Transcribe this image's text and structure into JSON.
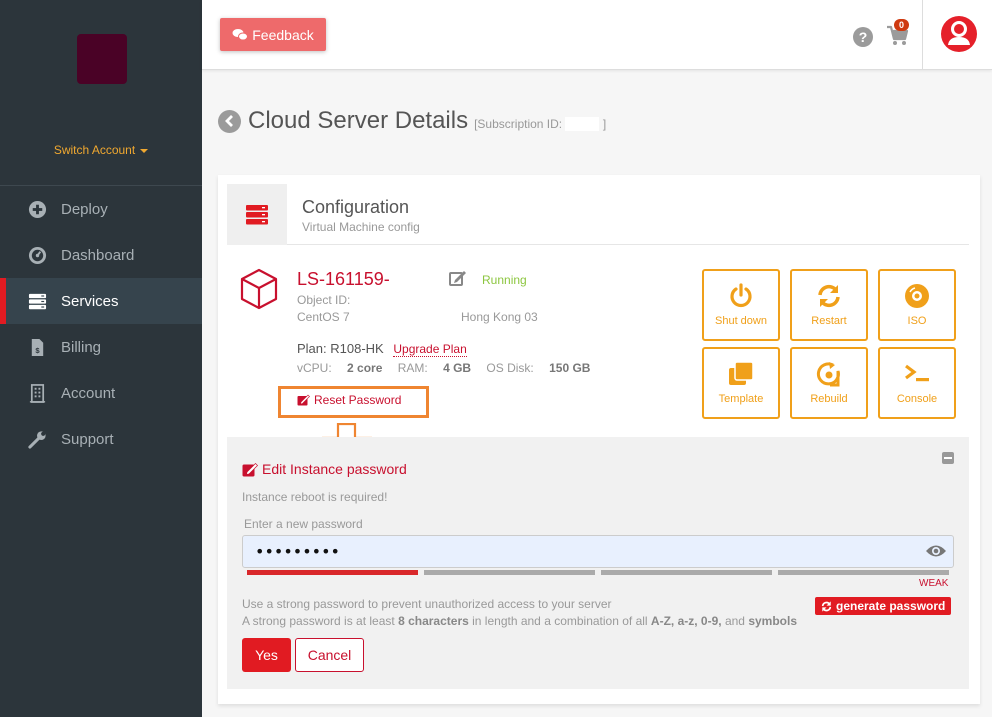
{
  "sidebar": {
    "switch_account_label": "Switch Account",
    "items": [
      {
        "label": "Deploy",
        "icon": "plus-circle-icon",
        "active": false
      },
      {
        "label": "Dashboard",
        "icon": "speedometer-icon",
        "active": false
      },
      {
        "label": "Services",
        "icon": "server-icon",
        "active": true
      },
      {
        "label": "Billing",
        "icon": "invoice-icon",
        "active": false
      },
      {
        "label": "Account",
        "icon": "building-icon",
        "active": false
      },
      {
        "label": "Support",
        "icon": "wrench-icon",
        "active": false
      }
    ]
  },
  "topbar": {
    "feedback_label": "Feedback",
    "help_glyph": "?",
    "cart_count": "0"
  },
  "page": {
    "title": "Cloud Server Details",
    "subscription_prefix": "[Subscription ID:",
    "subscription_suffix": "]"
  },
  "config": {
    "title": "Configuration",
    "subtitle": "Virtual Machine config"
  },
  "vm": {
    "name": "LS-161159-",
    "status": "Running",
    "status_color": "#8cc63f",
    "object_id_label": "Object ID:",
    "os": "CentOS 7",
    "region": "Hong Kong 03",
    "plan_label": "Plan:",
    "plan": "R108-HK",
    "upgrade_label": "Upgrade Plan",
    "vcpu_label": "vCPU:",
    "vcpu": "2 core",
    "ram_label": "RAM:",
    "ram": "4 GB",
    "disk_label": "OS Disk:",
    "disk": "150 GB",
    "reset_password_label": "Reset Password"
  },
  "actions": [
    {
      "label": "Shut down",
      "icon": "power-icon"
    },
    {
      "label": "Restart",
      "icon": "refresh-icon"
    },
    {
      "label": "ISO",
      "icon": "disc-icon"
    },
    {
      "label": "Template",
      "icon": "copy-icon"
    },
    {
      "label": "Rebuild",
      "icon": "rebuild-icon"
    },
    {
      "label": "Console",
      "icon": "terminal-icon"
    }
  ],
  "password_panel": {
    "title": "Edit Instance password",
    "reboot_note": "Instance reboot is required!",
    "field_label": "Enter a new password",
    "field_value": "•••••••••",
    "strength_level": "1 of 4",
    "strength_label": "WEAK",
    "hint_line1": "Use a strong password to prevent unauthorized access to your server",
    "hint_line2_a": "A strong password is at least ",
    "hint_line2_b": "8 characters",
    "hint_line2_c": " in length and a combination of all ",
    "hint_line2_d": "A-Z, a-z, 0-9,",
    "hint_line2_e": " and ",
    "hint_line2_f": "symbols",
    "generate_label": "generate password",
    "yes_label": "Yes",
    "cancel_label": "Cancel"
  },
  "colors": {
    "accent_red": "#e11b22",
    "action_orange": "#f0a01a",
    "annotation_orange": "#ef8531",
    "sidebar_bg": "#2c353b"
  }
}
